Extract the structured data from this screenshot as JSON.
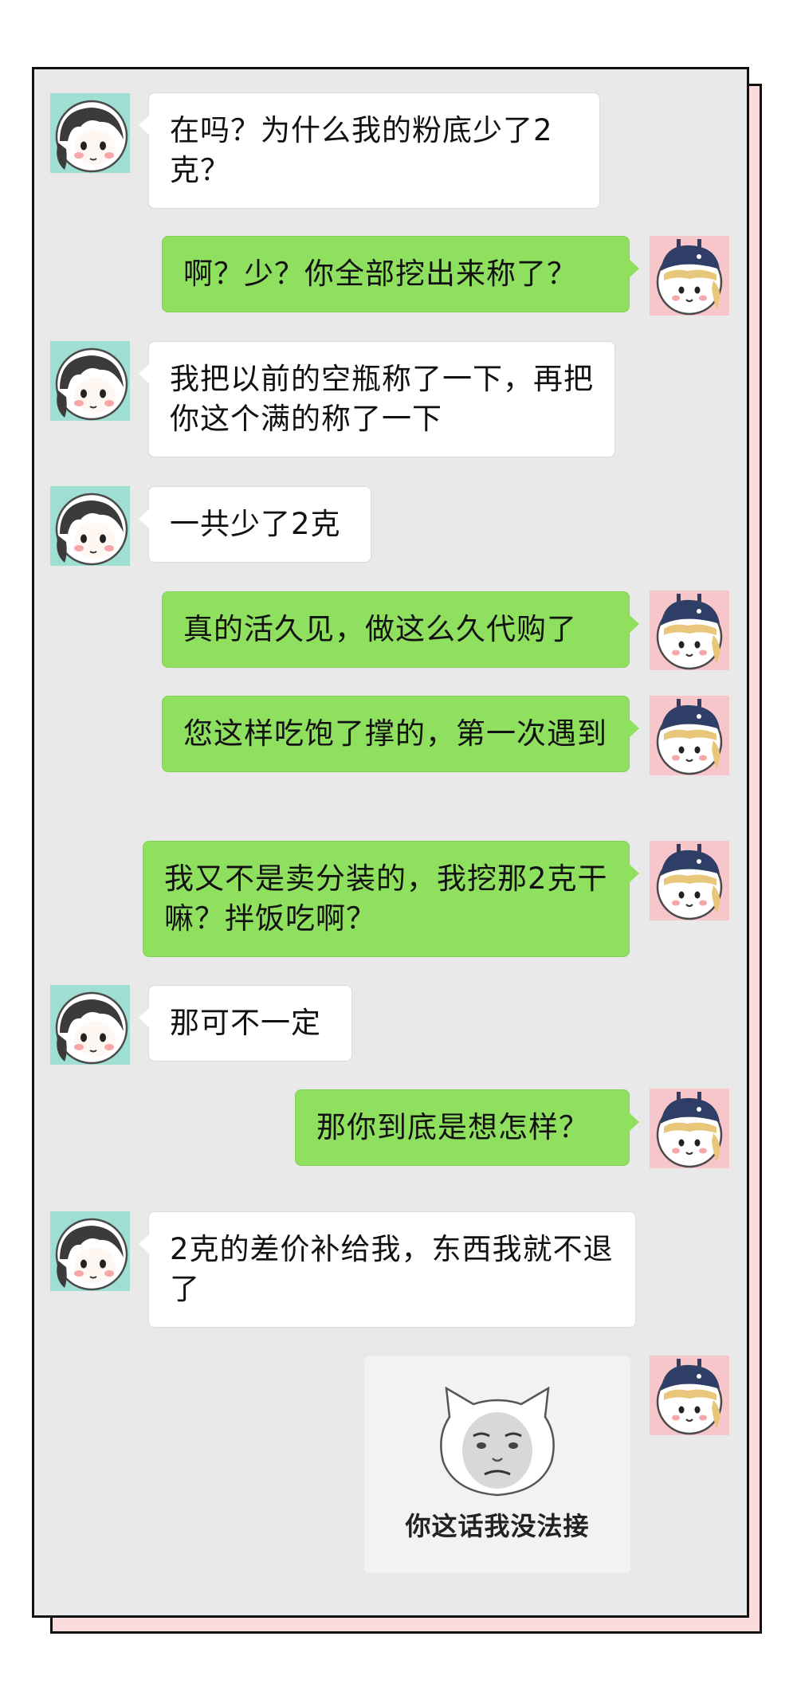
{
  "chat": {
    "messages": [
      {
        "side": "in",
        "text": "在吗？为什么我的粉底少了2克？"
      },
      {
        "side": "out",
        "text": "啊？少？你全部挖出来称了？"
      },
      {
        "side": "in",
        "text": "我把以前的空瓶称了一下，再把你这个满的称了一下"
      },
      {
        "side": "in",
        "text": "一共少了2克"
      },
      {
        "side": "out",
        "text": "真的活久见，做这么久代购了"
      },
      {
        "side": "out",
        "text": "您这样吃饱了撑的，第一次遇到"
      },
      {
        "side": "out",
        "text": "我又不是卖分装的，我挖那2克干嘛？拌饭吃啊？"
      },
      {
        "side": "in",
        "text": "那可不一定"
      },
      {
        "side": "out",
        "text": "那你到底是想怎样？"
      },
      {
        "side": "in",
        "text": "2克的差价补给我，东西我就不退了"
      }
    ],
    "sticker": {
      "side": "out",
      "caption": "你这话我没法接"
    }
  },
  "colors": {
    "incoming_bubble": "#ffffff",
    "outgoing_bubble": "#8fe05f",
    "chat_background": "#e9e9e9",
    "shadow_card": "#fbdcdc"
  },
  "icons": {
    "customer_avatar": "girl-avatar-dark-hair",
    "seller_avatar": "girl-avatar-navy-cap",
    "sticker": "cat-face-meme"
  }
}
